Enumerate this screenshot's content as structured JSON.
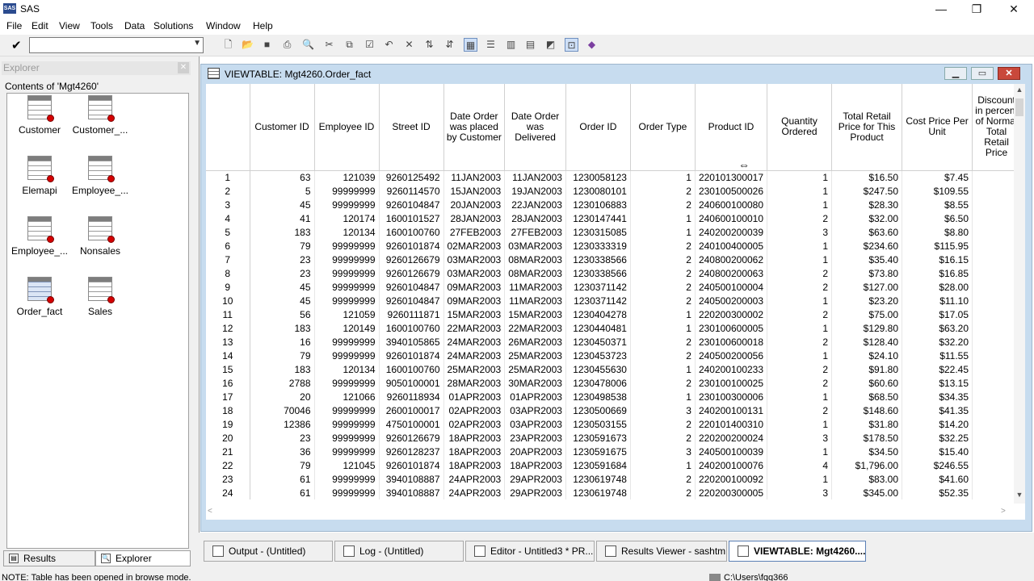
{
  "app": {
    "title": "SAS",
    "icon_label": "SAS"
  },
  "window_controls": {
    "minimize": "—",
    "maximize": "❐",
    "close": "✕"
  },
  "menu": [
    "File",
    "Edit",
    "View",
    "Tools",
    "Data",
    "Solutions",
    "Window",
    "Help"
  ],
  "toolbar": {
    "command_value": "",
    "icons": [
      "new-icon",
      "open-icon",
      "save-icon",
      "print-icon",
      "print-preview-icon",
      "cut-icon",
      "copy-icon",
      "paste-icon",
      "undo-icon",
      "delete-icon",
      "sort-ascending-icon",
      "sort-descending-icon",
      "table-view-icon",
      "form-view-icon",
      "column-labels-icon",
      "column-names-icon",
      "edit-mode-icon",
      "browse-mode-icon",
      "help-book-icon"
    ]
  },
  "explorer": {
    "header": "Explorer",
    "contents_label": "Contents of 'Mgt4260'",
    "items": [
      {
        "label": "Customer"
      },
      {
        "label": "Customer_..."
      },
      {
        "label": "Elemapi"
      },
      {
        "label": "Employee_..."
      },
      {
        "label": "Employee_..."
      },
      {
        "label": "Nonsales"
      },
      {
        "label": "Order_fact",
        "selected": true
      },
      {
        "label": "Sales"
      }
    ],
    "tabs": {
      "results": "Results",
      "explorer": "Explorer"
    }
  },
  "viewtable": {
    "title": "VIEWTABLE: Mgt4260.Order_fact",
    "columns": [
      "",
      "Customer ID",
      "Employee ID",
      "Street ID",
      "Date Order was placed by Customer",
      "Date Order was Delivered",
      "Order ID",
      "Order Type",
      "Product ID",
      "Quantity Ordered",
      "Total Retail Price for This Product",
      "Cost Price Per Unit",
      "Discount in percent of Normal Total Retail Price"
    ],
    "rows": [
      [
        "1",
        "63",
        "121039",
        "9260125492",
        "11JAN2003",
        "11JAN2003",
        "1230058123",
        "1",
        "220101300017",
        "1",
        "$16.50",
        "$7.45",
        "."
      ],
      [
        "2",
        "5",
        "99999999",
        "9260114570",
        "15JAN2003",
        "19JAN2003",
        "1230080101",
        "2",
        "230100500026",
        "1",
        "$247.50",
        "$109.55",
        "."
      ],
      [
        "3",
        "45",
        "99999999",
        "9260104847",
        "20JAN2003",
        "22JAN2003",
        "1230106883",
        "2",
        "240600100080",
        "1",
        "$28.30",
        "$8.55",
        "."
      ],
      [
        "4",
        "41",
        "120174",
        "1600101527",
        "28JAN2003",
        "28JAN2003",
        "1230147441",
        "1",
        "240600100010",
        "2",
        "$32.00",
        "$6.50",
        "."
      ],
      [
        "5",
        "183",
        "120134",
        "1600100760",
        "27FEB2003",
        "27FEB2003",
        "1230315085",
        "1",
        "240200200039",
        "3",
        "$63.60",
        "$8.80",
        "."
      ],
      [
        "6",
        "79",
        "99999999",
        "9260101874",
        "02MAR2003",
        "03MAR2003",
        "1230333319",
        "2",
        "240100400005",
        "1",
        "$234.60",
        "$115.95",
        "."
      ],
      [
        "7",
        "23",
        "99999999",
        "9260126679",
        "03MAR2003",
        "08MAR2003",
        "1230338566",
        "2",
        "240800200062",
        "1",
        "$35.40",
        "$16.15",
        "."
      ],
      [
        "8",
        "23",
        "99999999",
        "9260126679",
        "03MAR2003",
        "08MAR2003",
        "1230338566",
        "2",
        "240800200063",
        "2",
        "$73.80",
        "$16.85",
        "."
      ],
      [
        "9",
        "45",
        "99999999",
        "9260104847",
        "09MAR2003",
        "11MAR2003",
        "1230371142",
        "2",
        "240500100004",
        "2",
        "$127.00",
        "$28.00",
        "."
      ],
      [
        "10",
        "45",
        "99999999",
        "9260104847",
        "09MAR2003",
        "11MAR2003",
        "1230371142",
        "2",
        "240500200003",
        "1",
        "$23.20",
        "$11.10",
        "."
      ],
      [
        "11",
        "56",
        "121059",
        "9260111871",
        "15MAR2003",
        "15MAR2003",
        "1230404278",
        "1",
        "220200300002",
        "2",
        "$75.00",
        "$17.05",
        "."
      ],
      [
        "12",
        "183",
        "120149",
        "1600100760",
        "22MAR2003",
        "22MAR2003",
        "1230440481",
        "1",
        "230100600005",
        "1",
        "$129.80",
        "$63.20",
        "."
      ],
      [
        "13",
        "16",
        "99999999",
        "3940105865",
        "24MAR2003",
        "26MAR2003",
        "1230450371",
        "2",
        "230100600018",
        "2",
        "$128.40",
        "$32.20",
        "."
      ],
      [
        "14",
        "79",
        "99999999",
        "9260101874",
        "24MAR2003",
        "25MAR2003",
        "1230453723",
        "2",
        "240500200056",
        "1",
        "$24.10",
        "$11.55",
        "."
      ],
      [
        "15",
        "183",
        "120134",
        "1600100760",
        "25MAR2003",
        "25MAR2003",
        "1230455630",
        "1",
        "240200100233",
        "2",
        "$91.80",
        "$22.45",
        "."
      ],
      [
        "16",
        "2788",
        "99999999",
        "9050100001",
        "28MAR2003",
        "30MAR2003",
        "1230478006",
        "2",
        "230100100025",
        "2",
        "$60.60",
        "$13.15",
        "."
      ],
      [
        "17",
        "20",
        "121066",
        "9260118934",
        "01APR2003",
        "01APR2003",
        "1230498538",
        "1",
        "230100300006",
        "1",
        "$68.50",
        "$34.35",
        "."
      ],
      [
        "18",
        "70046",
        "99999999",
        "2600100017",
        "02APR2003",
        "03APR2003",
        "1230500669",
        "3",
        "240200100131",
        "2",
        "$148.60",
        "$41.35",
        "."
      ],
      [
        "19",
        "12386",
        "99999999",
        "4750100001",
        "02APR2003",
        "03APR2003",
        "1230503155",
        "2",
        "220101400310",
        "1",
        "$31.80",
        "$14.20",
        "."
      ],
      [
        "20",
        "23",
        "99999999",
        "9260126679",
        "18APR2003",
        "23APR2003",
        "1230591673",
        "2",
        "220200200024",
        "3",
        "$178.50",
        "$32.25",
        "."
      ],
      [
        "21",
        "36",
        "99999999",
        "9260128237",
        "18APR2003",
        "20APR2003",
        "1230591675",
        "3",
        "240500100039",
        "1",
        "$34.50",
        "$15.40",
        "."
      ],
      [
        "22",
        "79",
        "121045",
        "9260101874",
        "18APR2003",
        "18APR2003",
        "1230591684",
        "1",
        "240200100076",
        "4",
        "$1,796.00",
        "$246.55",
        "."
      ],
      [
        "23",
        "61",
        "99999999",
        "3940108887",
        "24APR2003",
        "29APR2003",
        "1230619748",
        "2",
        "220200100092",
        "1",
        "$83.00",
        "$41.60",
        "."
      ],
      [
        "24",
        "61",
        "99999999",
        "3940108887",
        "24APR2003",
        "29APR2003",
        "1230619748",
        "2",
        "220200300005",
        "3",
        "$345.00",
        "$52.35",
        "."
      ]
    ]
  },
  "window_tabs": [
    {
      "label": "Output - (Untitled)"
    },
    {
      "label": "Log - (Untitled)"
    },
    {
      "label": "Editor - Untitled3 *   PR..."
    },
    {
      "label": "Results Viewer - sashtm..."
    },
    {
      "label": "VIEWTABLE: Mgt4260....",
      "active": true
    }
  ],
  "status": {
    "message": "NOTE: Table has been opened in browse mode.",
    "path": "C:\\Users\\fqq366"
  }
}
